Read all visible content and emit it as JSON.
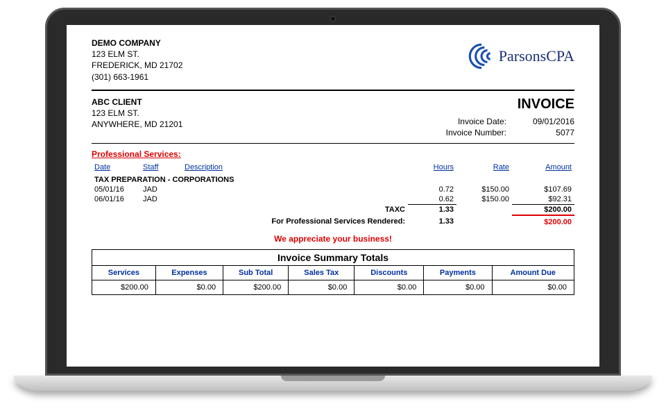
{
  "company": {
    "name": "DEMO COMPANY",
    "street": "123 ELM ST.",
    "citystatezip": "FREDERICK, MD  21702",
    "phone": "(301) 663-1961"
  },
  "logo": {
    "text": "ParsonsCPA"
  },
  "client": {
    "name": "ABC CLIENT",
    "street": "123 ELM ST.",
    "citystatezip": "ANYWHERE, MD  21201"
  },
  "invoice": {
    "title": "INVOICE",
    "date_label": "Invoice Date:",
    "date_value": "09/01/2016",
    "number_label": "Invoice Number:",
    "number_value": "5077"
  },
  "services": {
    "section_title": "Professional Services:",
    "columns": {
      "date": "Date",
      "staff": "Staff",
      "description": "Description",
      "hours": "Hours",
      "rate": "Rate",
      "amount": "Amount"
    },
    "group": "TAX PREPARATION - CORPORATIONS",
    "rows": [
      {
        "date": "05/01/16",
        "staff": "JAD",
        "description": "",
        "hours": "0.72",
        "rate": "$150.00",
        "amount": "$107.69"
      },
      {
        "date": "06/01/16",
        "staff": "JAD",
        "description": "",
        "hours": "0.62",
        "rate": "$150.00",
        "amount": "$92.31"
      }
    ],
    "subtotal": {
      "label": "TAXC",
      "hours": "1.33",
      "amount": "$200.00"
    },
    "grand": {
      "label": "For Professional Services Rendered:",
      "hours": "1.33",
      "amount": "$200.00"
    }
  },
  "appreciate": "We appreciate your business!",
  "summary": {
    "caption": "Invoice Summary Totals",
    "columns": {
      "services": "Services",
      "expenses": "Expenses",
      "subtotal": "Sub Total",
      "salestax": "Sales Tax",
      "discounts": "Discounts",
      "payments": "Payments",
      "amountdue": "Amount Due"
    },
    "values": {
      "services": "$200.00",
      "expenses": "$0.00",
      "subtotal": "$200.00",
      "salestax": "$0.00",
      "discounts": "$0.00",
      "payments": "$0.00",
      "amountdue": "$0.00"
    }
  }
}
